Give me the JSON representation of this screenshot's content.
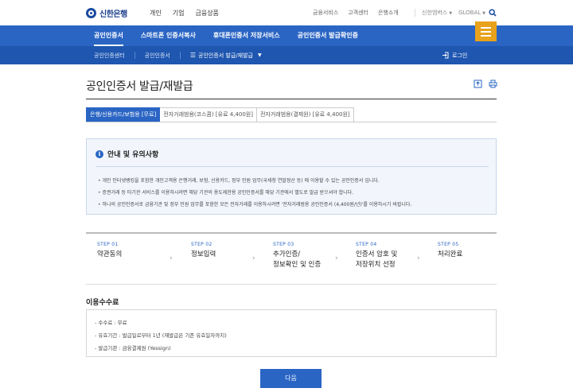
{
  "header": {
    "logo_text": "신한은행",
    "nav": [
      "개인",
      "기업",
      "금융상품"
    ],
    "util": [
      "금융서비스",
      "고객센터",
      "은행소개"
    ],
    "lang": [
      "신한엠버스",
      "GLOBAL"
    ]
  },
  "mainnav": {
    "items": [
      "공인인증서",
      "스마트폰 인증서복사",
      "휴대폰인증서 저장서비스",
      "공인인증서 발급확인증"
    ]
  },
  "breadcrumb": {
    "items": [
      "공인인증센터",
      "공인인증서",
      "공인인증서 발급/재발급"
    ],
    "login_label": "로그인"
  },
  "page": {
    "title": "공인인증서 발급/재발급"
  },
  "tabs": [
    "은행/신용카드/보험용 [무료]",
    "전자거래범용(코스콤) [유료 4,400원]",
    "전자거래범용(결제원) [유료 4,400원]"
  ],
  "notice": {
    "title": "안내 및 유의사항",
    "items": [
      "개인 인터넷뱅킹을 포함한 개인고객용 은행거래, 보험, 신용카드, 정부 민원 업무(국세청 연말정산 등) 에 이용할 수 있는 공인인증서 입니다.",
      "증권거래 등 타기관 서비스를 이용하시려면 해당 기관의 용도제한용 공인인증서를 해당 기관에서 별도로 발급 받으셔야 합니다.",
      "하나의 공인인증서로 금융기관 및 정부 민원 업무를 포함한 모든 전자거래를 이용하시려면 '전자거래범용 공인인증서 (4,400원/년)'를 이용하시기 바랍니다."
    ]
  },
  "steps": [
    {
      "num": "STEP 01",
      "label": "약관동의"
    },
    {
      "num": "STEP 02",
      "label": "정보입력"
    },
    {
      "num": "STEP 03",
      "label": "추가인증/\n정보확인 및 인증"
    },
    {
      "num": "STEP 04",
      "label": "인증서 암호 및\n저장위치 선정"
    },
    {
      "num": "STEP 05",
      "label": "처리완료"
    }
  ],
  "fee": {
    "title": "이용수수료",
    "items": [
      "수수료 : 무료",
      "유효기간 : 발급일로부터 1년 (재발급은 기존 유효일자까지)",
      "발급기관 : 금융결제원 (Yessign)"
    ]
  },
  "next_label": "다음",
  "colors": {
    "primary": "#2a65c4",
    "menu_accent": "#e8a21c"
  }
}
